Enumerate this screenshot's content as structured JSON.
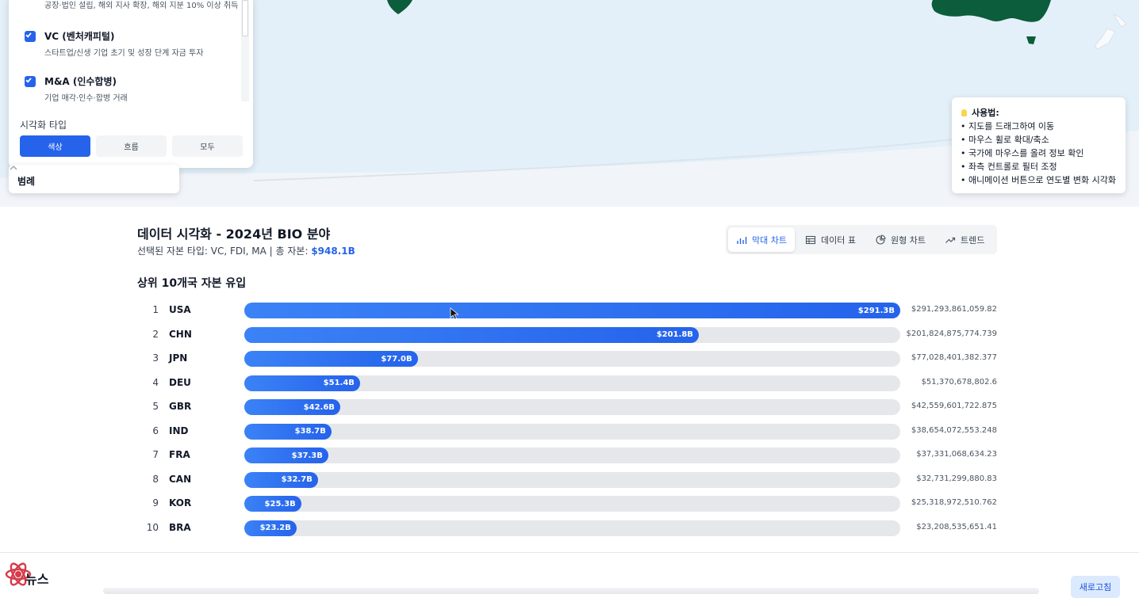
{
  "filter_panel": {
    "top_desc": "공장·법인 설립, 해외 지사 확장, 해외 지분 10% 이상 취득",
    "items": [
      {
        "label": "VC (벤처캐피털)",
        "desc": "스타트업/신생 기업 초기 및 성장 단계 자금 투자",
        "checked": true
      },
      {
        "label": "M&A (인수합병)",
        "desc": "기업 매각·인수·합병 거래",
        "checked": true
      }
    ],
    "viz_title": "시각화 타입",
    "viz_buttons": [
      "색상",
      "흐름",
      "모두"
    ],
    "viz_active": "색상"
  },
  "legend": {
    "title": "범례"
  },
  "usage": {
    "title": "사용법:",
    "lines": [
      "• 지도를 드래그하여 이동",
      "• 마우스 휠로 확대/축소",
      "• 국가에 마우스를 올려 정보 확인",
      "• 좌측 컨트롤로 필터 조정",
      "• 애니메이션 버튼으로 연도별 변화 시각화"
    ]
  },
  "section": {
    "title": "데이터 시각화 - 2024년 BIO 분야",
    "subtitle_prefix": "선택된 자본 타입: VC, FDI, MA | 총 자본: ",
    "subtitle_total": "$948.1B",
    "tabs": [
      "막대 차트",
      "데이터 표",
      "원형 차트",
      "트렌드"
    ],
    "active_tab": "막대 차트"
  },
  "chart_data": {
    "type": "bar",
    "title": "상위 10개국 자본 유입",
    "ranks": [
      "1",
      "2",
      "3",
      "4",
      "5",
      "6",
      "7",
      "8",
      "9",
      "10"
    ],
    "categories": [
      "USA",
      "CHN",
      "JPN",
      "DEU",
      "GBR",
      "IND",
      "FRA",
      "CAN",
      "KOR",
      "BRA"
    ],
    "values": [
      291.3,
      201.8,
      77.0,
      51.4,
      42.6,
      38.7,
      37.3,
      32.7,
      25.3,
      23.2
    ],
    "value_labels": [
      "$291.3B",
      "$201.8B",
      "$77.0B",
      "$51.4B",
      "$42.6B",
      "$38.7B",
      "$37.3B",
      "$32.7B",
      "$25.3B",
      "$23.2B"
    ],
    "raw_values": [
      "$291,293,861,059.82",
      "$201,824,875,774.739",
      "$77,028,401,382.377",
      "$51,370,678,802.6",
      "$42,559,601,722.875",
      "$38,654,072,553.248",
      "$37,331,068,634.23",
      "$32,731,299,880.83",
      "$25,318,972,510.762",
      "$23,208,535,651.41"
    ],
    "xlim": [
      0,
      291.3
    ]
  },
  "news": {
    "title": "뉴스",
    "refresh_label": "새로고침"
  },
  "colors": {
    "accent": "#2563eb",
    "map_sea": "#e4f0f9",
    "land": "#f8fafc",
    "highlight_land": "#0b5d3b"
  }
}
